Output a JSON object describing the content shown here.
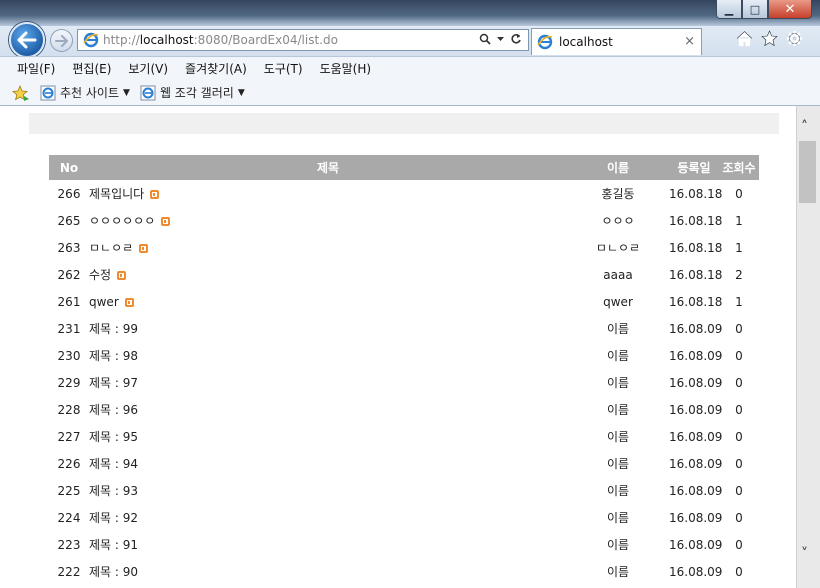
{
  "browser": {
    "url_prefix": "http://",
    "url_host": "localhost",
    "url_rest": ":8080/BoardEx04/list.do",
    "tab_title": "localhost",
    "tab_close": "×"
  },
  "menu": [
    "파일(F)",
    "편집(E)",
    "보기(V)",
    "즐겨찾기(A)",
    "도구(T)",
    "도움말(H)"
  ],
  "favorites": {
    "suggested_sites": "추천 사이트",
    "web_slice_gallery": "웹 조각 갤러리"
  },
  "board": {
    "headers": {
      "no": "No",
      "title": "제목",
      "writer": "이름",
      "date": "등록일",
      "hits": "조회수"
    },
    "rows": [
      {
        "no": "266",
        "title": "제목입니다",
        "new": true,
        "writer": "홍길동",
        "date": "16.08.18",
        "hits": "0"
      },
      {
        "no": "265",
        "title": "ㅇㅇㅇㅇㅇㅇ",
        "new": true,
        "writer": "ㅇㅇㅇ",
        "date": "16.08.18",
        "hits": "1"
      },
      {
        "no": "263",
        "title": "ㅁㄴㅇㄹ",
        "new": true,
        "writer": "ㅁㄴㅇㄹ",
        "date": "16.08.18",
        "hits": "1"
      },
      {
        "no": "262",
        "title": "수정",
        "new": true,
        "writer": "aaaa",
        "date": "16.08.18",
        "hits": "2"
      },
      {
        "no": "261",
        "title": "qwer",
        "new": true,
        "writer": "qwer",
        "date": "16.08.18",
        "hits": "1"
      },
      {
        "no": "231",
        "title": "제목 : 99",
        "new": false,
        "writer": "이름",
        "date": "16.08.09",
        "hits": "0"
      },
      {
        "no": "230",
        "title": "제목 : 98",
        "new": false,
        "writer": "이름",
        "date": "16.08.09",
        "hits": "0"
      },
      {
        "no": "229",
        "title": "제목 : 97",
        "new": false,
        "writer": "이름",
        "date": "16.08.09",
        "hits": "0"
      },
      {
        "no": "228",
        "title": "제목 : 96",
        "new": false,
        "writer": "이름",
        "date": "16.08.09",
        "hits": "0"
      },
      {
        "no": "227",
        "title": "제목 : 95",
        "new": false,
        "writer": "이름",
        "date": "16.08.09",
        "hits": "0"
      },
      {
        "no": "226",
        "title": "제목 : 94",
        "new": false,
        "writer": "이름",
        "date": "16.08.09",
        "hits": "0"
      },
      {
        "no": "225",
        "title": "제목 : 93",
        "new": false,
        "writer": "이름",
        "date": "16.08.09",
        "hits": "0"
      },
      {
        "no": "224",
        "title": "제목 : 92",
        "new": false,
        "writer": "이름",
        "date": "16.08.09",
        "hits": "0"
      },
      {
        "no": "223",
        "title": "제목 : 91",
        "new": false,
        "writer": "이름",
        "date": "16.08.09",
        "hits": "0"
      },
      {
        "no": "222",
        "title": "제목 : 90",
        "new": false,
        "writer": "이름",
        "date": "16.08.09",
        "hits": "0"
      }
    ]
  },
  "colors": {
    "header_bg": "#a9a9a9",
    "new_badge": "#f08a2c",
    "back_button": "#1f5fa9"
  },
  "icons": [
    "back-arrow-icon",
    "forward-arrow-icon",
    "ie-logo-icon",
    "search-icon",
    "refresh-icon",
    "home-icon",
    "favorites-star-icon",
    "settings-gear-icon",
    "add-favorites-icon",
    "new-post-icon"
  ]
}
